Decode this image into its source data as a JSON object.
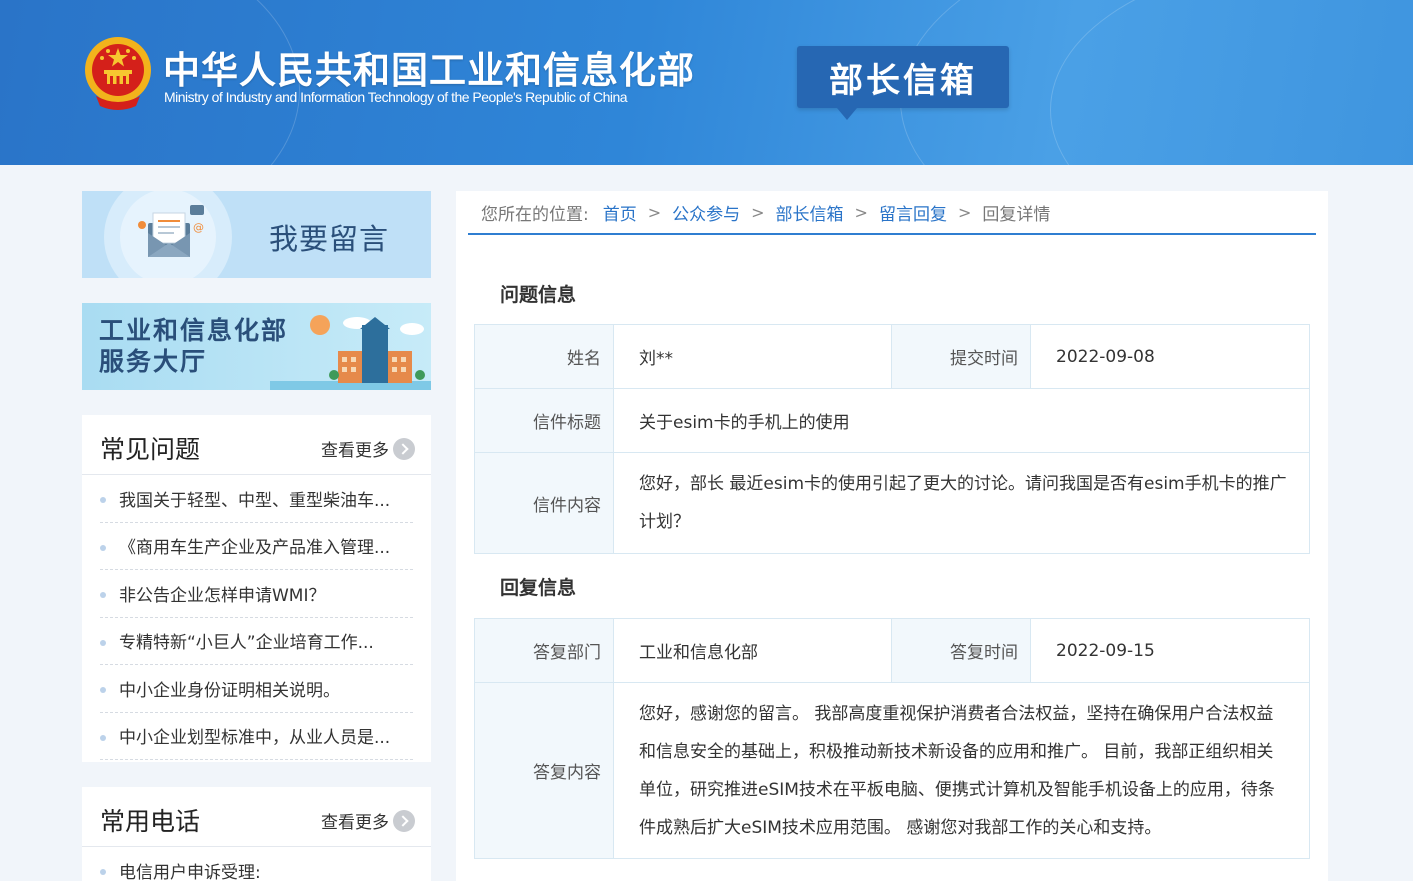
{
  "header": {
    "ministry_name_cn": "中华人民共和国工业和信息化部",
    "ministry_name_en": "Ministry of Industry and Information Technology of the People's Republic of China",
    "section_badge": "部长信箱"
  },
  "sidebar": {
    "leave_message_banner": "我要留言",
    "service_hall_banner_line1": "工业和信息化部",
    "service_hall_banner_line2": "服务大厅",
    "faq": {
      "title": "常见问题",
      "more_label": "查看更多",
      "items": [
        {
          "label": "我国关于轻型、中型、重型柴油车..."
        },
        {
          "label": "《商用车生产企业及产品准入管理..."
        },
        {
          "label": "非公告企业怎样申请WMI？"
        },
        {
          "label": "专精特新“小巨人”企业培育工作..."
        },
        {
          "label": "中小企业身份证明相关说明。"
        },
        {
          "label": "中小企业划型标准中，从业人员是..."
        }
      ]
    },
    "phones": {
      "title": "常用电话",
      "more_label": "查看更多",
      "items": [
        {
          "label": "电信用户申诉受理:"
        }
      ]
    }
  },
  "breadcrumb": {
    "prefix": "您所在的位置:",
    "links": [
      "首页",
      "公众参与",
      "部长信箱",
      "留言回复"
    ],
    "current": "回复详情"
  },
  "question": {
    "section_title": "问题信息",
    "name_label": "姓名",
    "name_value": "刘**",
    "submit_time_label": "提交时间",
    "submit_time_value": "2022-09-08",
    "subject_label": "信件标题",
    "subject_value": "关于esim卡的手机上的使用",
    "content_label": "信件内容",
    "content_value": "您好，部长 最近esim卡的使用引起了更大的讨论。请问我国是否有esim手机卡的推广计划？"
  },
  "reply": {
    "section_title": "回复信息",
    "dept_label": "答复部门",
    "dept_value": "工业和信息化部",
    "reply_time_label": "答复时间",
    "reply_time_value": "2022-09-15",
    "content_label": "答复内容",
    "content_value": "您好，感谢您的留言。 我部高度重视保护消费者合法权益，坚持在确保用户合法权益和信息安全的基础上，积极推动新技术新设备的应用和推广。 目前，我部正组织相关单位，研究推进eSIM技术在平板电脑、便携式计算机及智能手机设备上的应用，待条件成熟后扩大eSIM技术应用范围。 感谢您对我部工作的关心和支持。"
  },
  "colors": {
    "header_blue": "#2f86d8",
    "link_blue": "#2a74c8",
    "label_bg": "#f2f8fc"
  }
}
